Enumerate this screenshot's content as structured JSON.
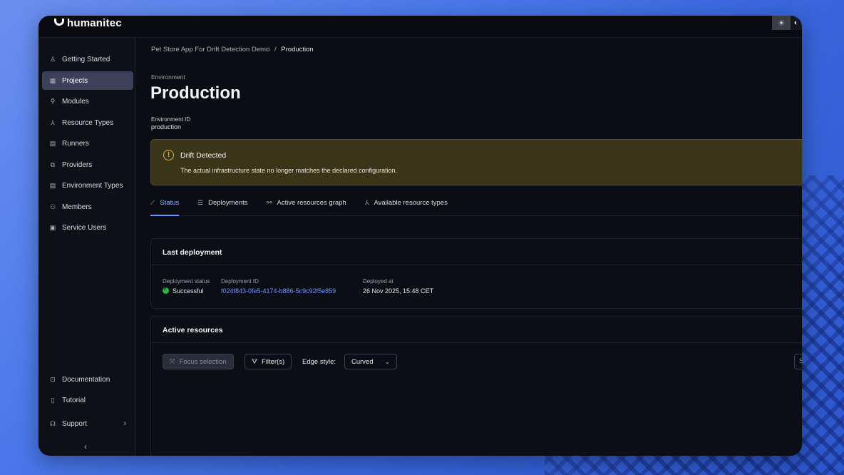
{
  "brand": {
    "name": "humanitec"
  },
  "theme_toggle": {
    "light_icon": "☀",
    "dark_icon": "◐"
  },
  "sidebar": {
    "items": [
      {
        "label": "Getting Started",
        "icon": "rocket-icon",
        "glyph": "♙"
      },
      {
        "label": "Projects",
        "icon": "grid-icon",
        "glyph": "▦",
        "active": true
      },
      {
        "label": "Modules",
        "icon": "link-icon",
        "glyph": "⚲"
      },
      {
        "label": "Resource Types",
        "icon": "hierarchy-icon",
        "glyph": "⅄"
      },
      {
        "label": "Runners",
        "icon": "runner-icon",
        "glyph": "▤"
      },
      {
        "label": "Providers",
        "icon": "provider-icon",
        "glyph": "⧉"
      },
      {
        "label": "Environment Types",
        "icon": "env-type-icon",
        "glyph": "▤"
      },
      {
        "label": "Members",
        "icon": "members-icon",
        "glyph": "⚇"
      },
      {
        "label": "Service Users",
        "icon": "service-user-icon",
        "glyph": "▣"
      }
    ],
    "bottom_items": [
      {
        "label": "Documentation",
        "icon": "doc-icon",
        "glyph": "⊡"
      },
      {
        "label": "Tutorial",
        "icon": "book-icon",
        "glyph": "▯"
      },
      {
        "label": "Support",
        "icon": "headset-icon",
        "glyph": "☊",
        "chevron": "›"
      }
    ],
    "collapse_glyph": "‹"
  },
  "breadcrumb": {
    "parent": "Pet Store App For Drift Detection Demo",
    "separator": "/",
    "current": "Production"
  },
  "header": {
    "env_label": "Environment",
    "title": "Production",
    "env_id_label": "Environment ID",
    "env_id_value": "production"
  },
  "alert": {
    "icon_glyph": "!",
    "title": "Drift Detected",
    "message": "The actual infrastructure state no longer matches the declared configuration."
  },
  "tabs": [
    {
      "label": "Status",
      "glyph": "⟋",
      "active": true
    },
    {
      "label": "Deployments",
      "glyph": "☰"
    },
    {
      "label": "Active resources graph",
      "glyph": "⚯"
    },
    {
      "label": "Available resource types",
      "glyph": "⅄"
    }
  ],
  "last_deployment": {
    "title": "Last deployment",
    "status_label": "Deployment status",
    "status_value": "Successful",
    "id_label": "Deployment ID",
    "id_value": "f024f843-0fe5-4174-b886-5c9c92f5e859",
    "deployed_label": "Deployed at",
    "deployed_value": "26 Nov 2025, 15:48 CET"
  },
  "active_resources": {
    "title": "Active resources",
    "focus_label": "Focus selection",
    "filter_label": "Filter(s)",
    "edge_label": "Edge style:",
    "edge_value": "Curved",
    "search_stub": "Se"
  },
  "colors": {
    "accent": "#6f95ff",
    "success": "#2fb24c",
    "warning": "#e0b54a",
    "alert_bg": "#3a3418"
  }
}
